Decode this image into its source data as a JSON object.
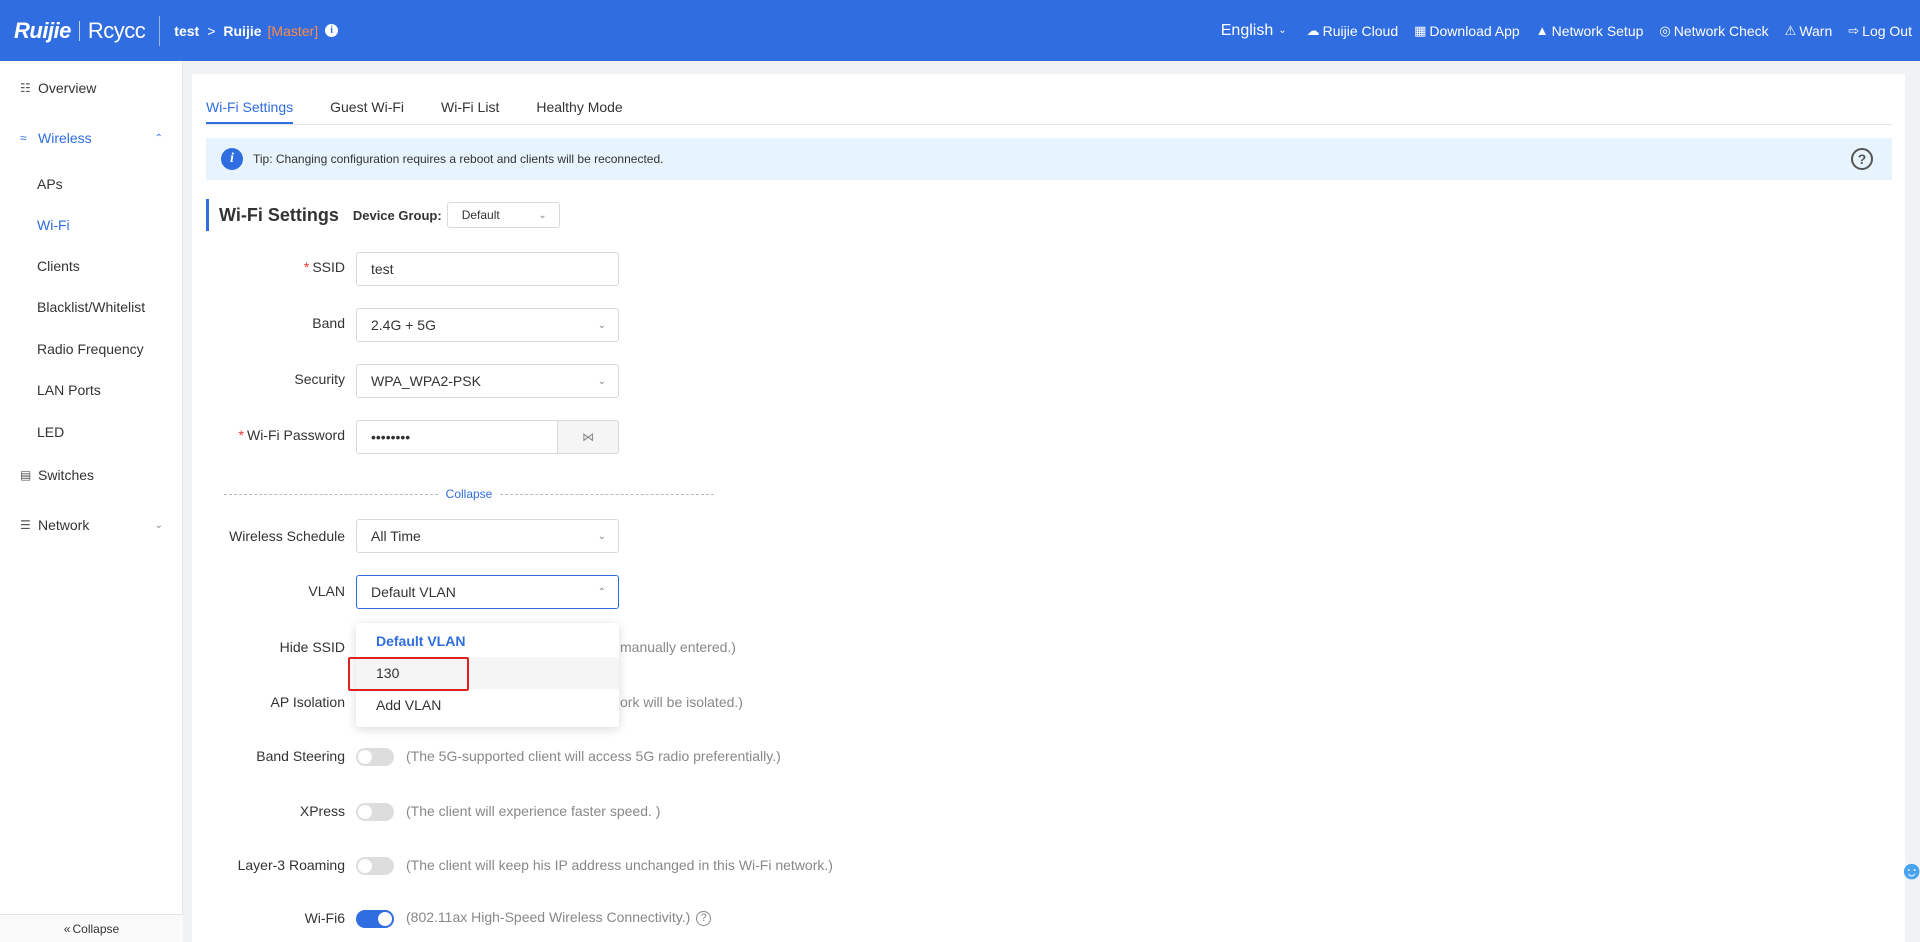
{
  "header": {
    "logo_primary": "Ruijie",
    "logo_secondary": "Rcycc",
    "crumb_project": "test",
    "crumb_separator": ">",
    "crumb_device": "Ruijie",
    "crumb_role": "[Master]",
    "language": "English",
    "links": [
      {
        "label": "Ruijie Cloud",
        "icon": "cloud-icon"
      },
      {
        "label": "Download App",
        "icon": "qr-code-icon"
      },
      {
        "label": "Network Setup",
        "icon": "network-setup-icon"
      },
      {
        "label": "Network Check",
        "icon": "network-check-icon"
      },
      {
        "label": "Warn",
        "icon": "warn-icon"
      },
      {
        "label": "Log Out",
        "icon": "logout-icon"
      }
    ],
    "brand_color": "#2f6de1"
  },
  "sidebar": {
    "overview": "Overview",
    "wireless": "Wireless",
    "wireless_items": [
      "APs",
      "Wi-Fi",
      "Clients",
      "Blacklist/Whitelist",
      "Radio Frequency",
      "LAN Ports",
      "LED"
    ],
    "switches": "Switches",
    "network": "Network",
    "collapse": "Collapse"
  },
  "tabs": [
    "Wi-Fi Settings",
    "Guest Wi-Fi",
    "Wi-Fi List",
    "Healthy Mode"
  ],
  "tip": "Tip: Changing configuration requires a reboot and clients will be reconnected.",
  "section": {
    "title": "Wi-Fi Settings",
    "device_group_label": "Device Group:",
    "device_group_value": "Default"
  },
  "form": {
    "ssid_label": "SSID",
    "ssid_value": "test",
    "band_label": "Band",
    "band_value": "2.4G + 5G",
    "security_label": "Security",
    "security_value": "WPA_WPA2-PSK",
    "password_label": "Wi-Fi Password",
    "password_value": "••••••••",
    "collapse_label": "Collapse",
    "schedule_label": "Wireless Schedule",
    "schedule_value": "All Time",
    "vlan_label": "VLAN",
    "vlan_value": "Default VLAN",
    "hide_ssid_label": "Hide SSID",
    "hide_ssid_hint": "manually entered.)",
    "ap_isolation_label": "AP Isolation",
    "ap_isolation_hint": "ork will be isolated.)",
    "band_steering_label": "Band Steering",
    "band_steering_hint": "(The 5G-supported client will access 5G radio preferentially.)",
    "xpress_label": "XPress",
    "xpress_hint": "(The client will experience faster speed. )",
    "roaming_label": "Layer-3 Roaming",
    "roaming_hint": "(The client will keep his IP address unchanged in this Wi-Fi network.)",
    "wifi6_label": "Wi-Fi6",
    "wifi6_hint": "(802.11ax High-Speed Wireless Connectivity.)"
  },
  "vlan_dropdown": {
    "options": [
      "Default VLAN",
      "130",
      "Add VLAN"
    ]
  }
}
